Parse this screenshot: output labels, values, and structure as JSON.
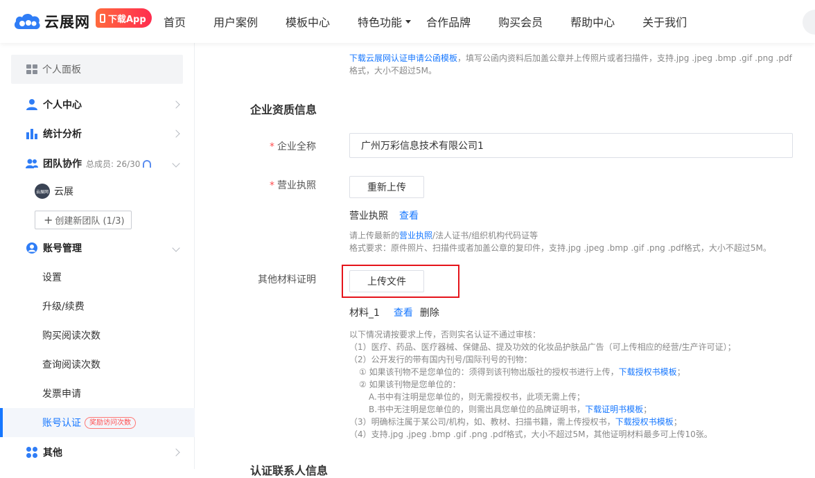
{
  "header": {
    "brand": "云展网",
    "download_app": "下载App",
    "nav": [
      {
        "label": "首页"
      },
      {
        "label": "用户案例"
      },
      {
        "label": "模板中心"
      },
      {
        "label": "特色功能"
      },
      {
        "label": "合作品牌"
      },
      {
        "label": "购买会员"
      },
      {
        "label": "帮助中心"
      },
      {
        "label": "关于我们"
      }
    ]
  },
  "sidebar": {
    "panel": "个人面板",
    "personal_center": "个人中心",
    "statistics": "统计分析",
    "team": "团队协作",
    "team_members": "总成员: 26/30",
    "team_name": "云展",
    "team_avatar_text": "云展网",
    "create_team": "创建新团队 (1/3)",
    "account": "账号管理",
    "account_items": [
      {
        "label": "设置"
      },
      {
        "label": "升级/续费"
      },
      {
        "label": "购买阅读次数"
      },
      {
        "label": "查询阅读次数"
      },
      {
        "label": "发票申请"
      },
      {
        "label": "账号认证"
      }
    ],
    "reward_badge": "奖励访问次数",
    "other": "其他"
  },
  "main": {
    "top_tip_link": "下载云展网认证申请公函模板",
    "top_tip_text": "，填写公函内资料后加盖公章并上传照片或者扫描件，支持.jpg .jpeg .bmp .gif .png .pdf格式，大小不超过5M。",
    "section_title": "企业资质信息",
    "company_label": "企业全称",
    "company_value": "广州万彩信息技术有限公司1",
    "license_label": "营业执照",
    "reupload": "重新上传",
    "license_file": "营业执照",
    "view": "查看",
    "license_hint_prefix": "请上传最新的",
    "license_hint_link": "营业执照",
    "license_hint_suffix": "/法人证书/组织机构代码证等",
    "license_format": "格式要求：原件照片、扫描件或者加盖公章的复印件，支持.jpg .jpeg .bmp .gif .png .pdf格式，大小不超过5M。",
    "other_label": "其他材料证明",
    "upload_file": "上传文件",
    "material_file": "材料_1",
    "material_view": "查看",
    "material_delete": "删除",
    "req_intro": "以下情况请按要求上传，否则实名认证不通过审核：",
    "req_1": "（1）医疗、药品、医疗器械、保健品、提及功效的化妆品护肤品广告（可上传相应的经营/生产许可证）；",
    "req_2": "（2）公开发行的带有国内刊号/国际刊号的刊物：",
    "req_2a_text": "① 如果该刊物不是您单位的：须得到该刊物出版社的授权书进行上传，",
    "req_2a_link": "下载授权书模板",
    "req_2b": "② 如果该刊物是您单位的：",
    "req_2b_a": "A.书中有注明是您单位的，则无需授权书，此项无需上传；",
    "req_2b_b_text": "B.书中无注明是您单位的，则需出具您单位的品牌证明书，",
    "req_2b_b_link": "下载证明书模板",
    "req_3_text": "（3）明确标注属于某公司/机构，如、教材、扫描书籍，需上传授权书，",
    "req_3_link": "下载授权书模板",
    "req_4": "（4）支持.jpg .jpeg .bmp .gif .png .pdf格式，大小不超过5M，其他证明材料最多可上传10张。",
    "next_section": "认证联系人信息"
  },
  "colors": {
    "accent": "#1677ff",
    "highlight": "#e5131a",
    "required": "#ff4d4f"
  }
}
